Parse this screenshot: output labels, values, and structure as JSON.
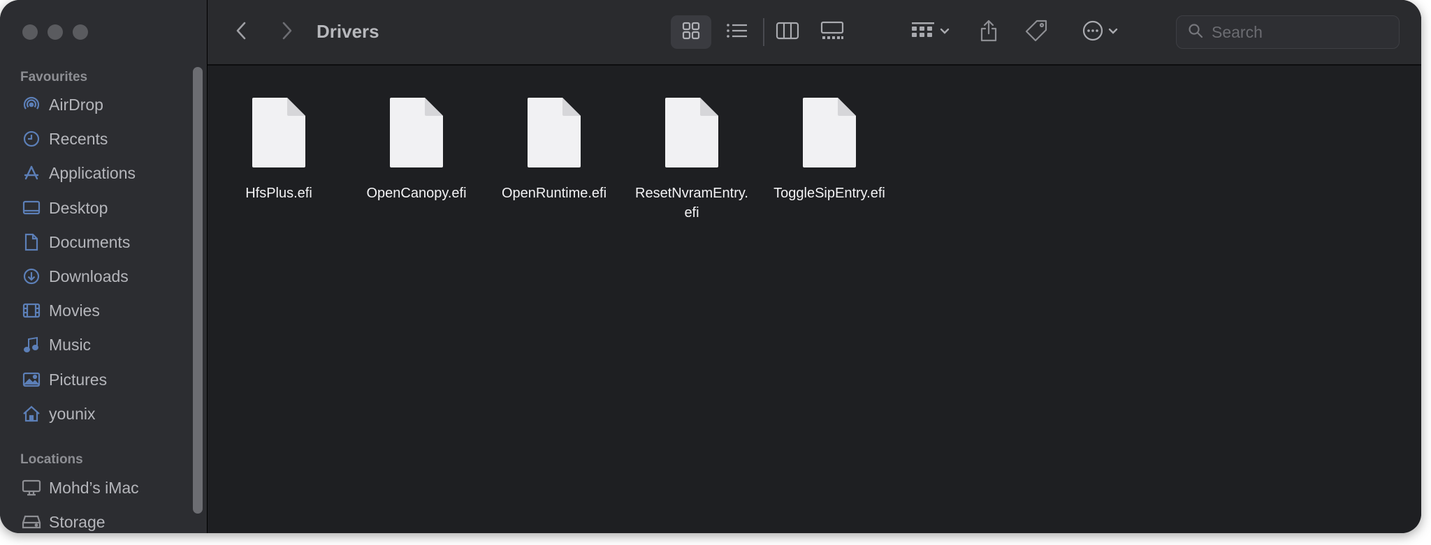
{
  "window": {
    "title": "Drivers"
  },
  "sidebar": {
    "favourites_header": "Favourites",
    "favourites": [
      {
        "label": "AirDrop",
        "icon": "airdrop-icon"
      },
      {
        "label": "Recents",
        "icon": "clock-icon"
      },
      {
        "label": "Applications",
        "icon": "applications-icon"
      },
      {
        "label": "Desktop",
        "icon": "desktop-icon"
      },
      {
        "label": "Documents",
        "icon": "document-icon"
      },
      {
        "label": "Downloads",
        "icon": "download-icon"
      },
      {
        "label": "Movies",
        "icon": "film-icon"
      },
      {
        "label": "Music",
        "icon": "music-note-icon"
      },
      {
        "label": "Pictures",
        "icon": "picture-icon"
      },
      {
        "label": "younix",
        "icon": "home-icon"
      }
    ],
    "locations_header": "Locations",
    "locations": [
      {
        "label": "Mohd’s iMac",
        "icon": "computer-icon"
      },
      {
        "label": "Storage",
        "icon": "disk-icon"
      }
    ]
  },
  "toolbar": {
    "search_placeholder": "Search",
    "view_modes": [
      "icon-view",
      "list-view",
      "column-view",
      "gallery-view"
    ],
    "active_view": "icon-view"
  },
  "files": [
    {
      "name": "HfsPlus.efi"
    },
    {
      "name": "OpenCanopy.efi"
    },
    {
      "name": "OpenRuntime.efi"
    },
    {
      "name": "ResetNvramEntry.\nefi"
    },
    {
      "name": "ToggleSipEntry.efi"
    }
  ],
  "colors": {
    "window_bg": "#1e1f22",
    "sidebar_bg": "#2c2d31",
    "toolbar_bg": "#2a2b2e",
    "text_primary": "#f2f2f4",
    "text_secondary": "#b5b6bb",
    "icon_tint": "#5c7fb7"
  }
}
